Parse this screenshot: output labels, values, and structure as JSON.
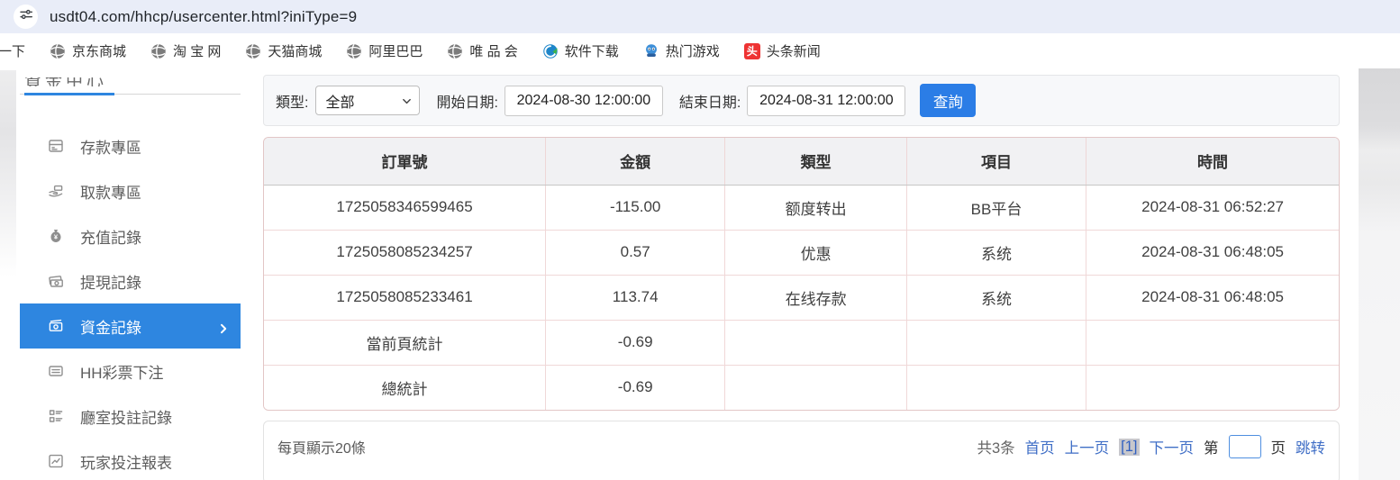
{
  "browser": {
    "url": "usdt04.com/hhcp/usercenter.html?iniType=9"
  },
  "bookmarks": [
    {
      "label": "一下",
      "icon": "none"
    },
    {
      "label": "京东商城",
      "icon": "globe"
    },
    {
      "label": "淘 宝 网",
      "icon": "globe"
    },
    {
      "label": "天猫商城",
      "icon": "globe"
    },
    {
      "label": "阿里巴巴",
      "icon": "globe"
    },
    {
      "label": "唯 品 会",
      "icon": "globe"
    },
    {
      "label": "软件下载",
      "icon": "software"
    },
    {
      "label": "热门游戏",
      "icon": "game"
    },
    {
      "label": "头条新闻",
      "icon": "toutiao",
      "badge_char": "头"
    }
  ],
  "sidebar": {
    "header_partial": "資金中心",
    "items": [
      {
        "label": "存款專區",
        "icon": "deposit-card-icon",
        "active": false
      },
      {
        "label": "取款專區",
        "icon": "withdraw-hand-icon",
        "active": false
      },
      {
        "label": "充值記錄",
        "icon": "moneybag-icon",
        "active": false
      },
      {
        "label": "提現記錄",
        "icon": "cash-note-icon",
        "active": false
      },
      {
        "label": "資金記錄",
        "icon": "funds-record-icon",
        "active": true
      },
      {
        "label": "HH彩票下注",
        "icon": "lottery-list-icon",
        "active": false
      },
      {
        "label": "廳室投註記錄",
        "icon": "hall-checklist-icon",
        "active": false
      },
      {
        "label": "玩家投注報表",
        "icon": "report-chart-icon",
        "active": false
      }
    ]
  },
  "filters": {
    "type_label": "類型:",
    "type_value": "全部",
    "start_label": "開始日期:",
    "start_value": "2024-08-30 12:00:00",
    "end_label": "結束日期:",
    "end_value": "2024-08-31 12:00:00",
    "query_button": "查詢"
  },
  "table": {
    "headers": [
      "訂單號",
      "金額",
      "類型",
      "項目",
      "時間"
    ],
    "rows": [
      [
        "1725058346599465",
        "-115.00",
        "额度转出",
        "BB平台",
        "2024-08-31 06:52:27"
      ],
      [
        "1725058085234257",
        "0.57",
        "优惠",
        "系统",
        "2024-08-31 06:48:05"
      ],
      [
        "1725058085233461",
        "113.74",
        "在线存款",
        "系统",
        "2024-08-31 06:48:05"
      ],
      [
        "當前頁統計",
        "-0.69",
        "",
        "",
        ""
      ],
      [
        "總統計",
        "-0.69",
        "",
        "",
        ""
      ]
    ]
  },
  "pagination": {
    "per_page": "每頁顯示20條",
    "total": "共3条",
    "first": "首页",
    "prev": "上一页",
    "current": "[1]",
    "next": "下一页",
    "jump_prefix": "第",
    "jump_suffix": "页",
    "jump_action": "跳转",
    "jump_value": ""
  },
  "colors": {
    "accent_blue": "#2e86e0",
    "button_blue": "#2b7de6",
    "link_blue": "#3f6ec6",
    "table_border_pink": "#f0d8d8",
    "browser_bar": "#e9edf8"
  }
}
